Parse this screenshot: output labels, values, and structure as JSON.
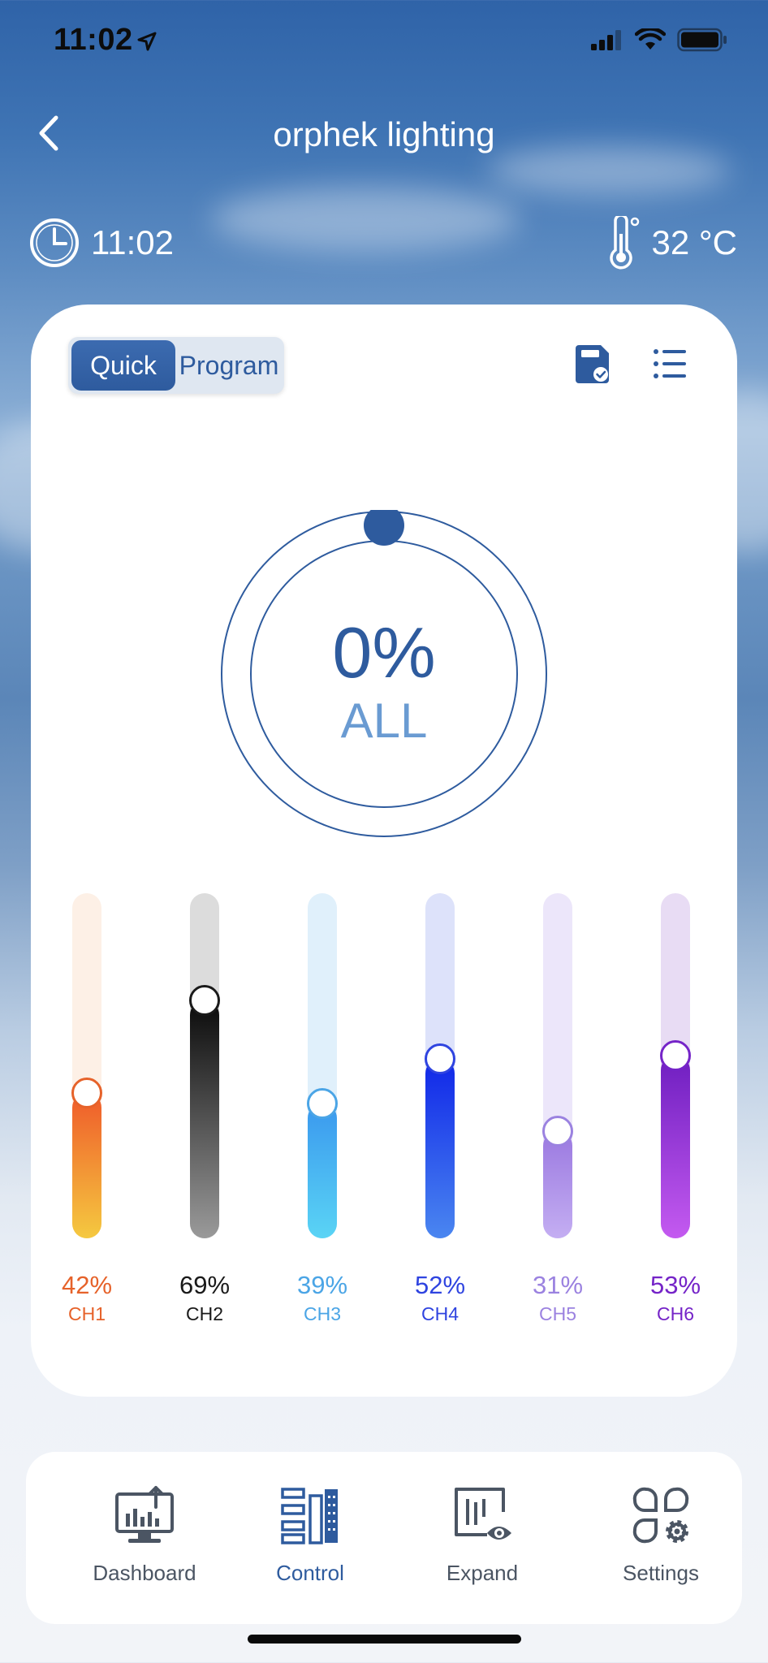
{
  "status_bar": {
    "time": "11:02"
  },
  "nav": {
    "title": "orphek lighting"
  },
  "info": {
    "time": "11:02",
    "temperature": "32 °C"
  },
  "mode_toggle": {
    "quick_label": "Quick",
    "program_label": "Program",
    "selected": "Quick"
  },
  "master": {
    "value": "0%",
    "label": "ALL"
  },
  "channels": [
    {
      "name": "CH1",
      "value": "42%",
      "level": 0.42,
      "color": "#e6622a"
    },
    {
      "name": "CH2",
      "value": "69%",
      "level": 0.69,
      "color": "#1a1a1a"
    },
    {
      "name": "CH3",
      "value": "39%",
      "level": 0.39,
      "color": "#4ba5e6"
    },
    {
      "name": "CH4",
      "value": "52%",
      "level": 0.52,
      "color": "#2f44e0"
    },
    {
      "name": "CH5",
      "value": "31%",
      "level": 0.31,
      "color": "#9b82e0"
    },
    {
      "name": "CH6",
      "value": "53%",
      "level": 0.53,
      "color": "#7524c8"
    }
  ],
  "tabbar": {
    "tabs": [
      {
        "label": "Dashboard",
        "icon": "dashboard-icon",
        "active": false
      },
      {
        "label": "Control",
        "icon": "control-icon",
        "active": true
      },
      {
        "label": "Expand",
        "icon": "expand-icon",
        "active": false
      },
      {
        "label": "Settings",
        "icon": "settings-icon",
        "active": false
      }
    ]
  },
  "colors": {
    "accent": "#2e5b9e",
    "accent_light": "#6a9bd2"
  }
}
